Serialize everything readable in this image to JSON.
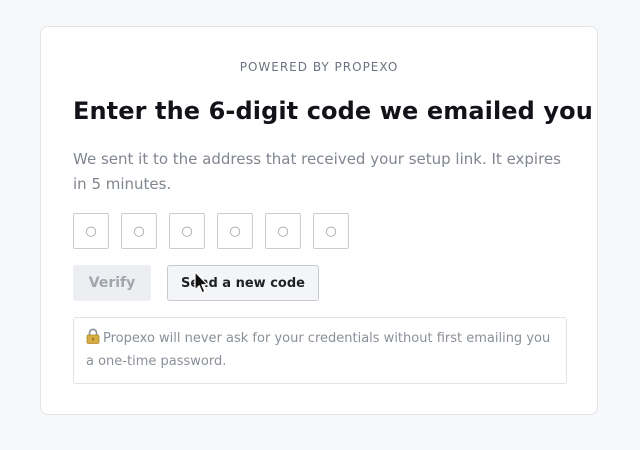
{
  "brand": {
    "text": "POWERED BY PROPEXO"
  },
  "heading": "Enter the 6-digit code we emailed you",
  "description": "We sent it to the address that received your setup link. It expires in 5 minutes.",
  "otp": {
    "digits": [
      {
        "value": "",
        "placeholder": "○"
      },
      {
        "value": "",
        "placeholder": "○"
      },
      {
        "value": "",
        "placeholder": "○"
      },
      {
        "value": "",
        "placeholder": "○"
      },
      {
        "value": "",
        "placeholder": "○"
      },
      {
        "value": "",
        "placeholder": "○"
      }
    ]
  },
  "buttons": {
    "verify_label": "Verify",
    "resend_label": "Send a new code"
  },
  "notice": {
    "icon": "lock-icon",
    "text": "Propexo will never ask for your credentials without first emailing you a one-time password."
  },
  "colors": {
    "page_bg": "#f7f8fa",
    "card_border": "#e1e4e8",
    "heading": "#111318",
    "muted_text": "#80868f",
    "disabled_button_bg": "#eceef1"
  },
  "cursor": {
    "icon": "mouse-pointer-icon"
  }
}
